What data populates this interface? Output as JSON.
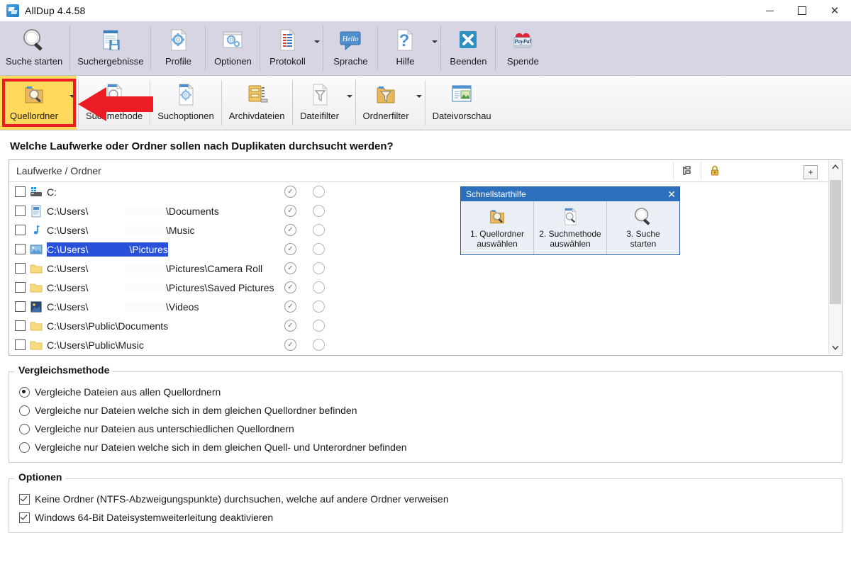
{
  "window": {
    "title": "AllDup 4.4.58",
    "app_icon": "alldup-logo-icon",
    "controls": {
      "minimize": "–",
      "maximize": "□",
      "close": "✕"
    }
  },
  "ribbon_top": {
    "buttons": [
      {
        "label": "Suche starten",
        "icon": "magnifier-icon",
        "has_dropdown": false
      },
      {
        "label": "Suchergebnisse",
        "icon": "results-save-icon",
        "has_dropdown": false
      },
      {
        "label": "Profile",
        "icon": "profile-gear-page-icon",
        "has_dropdown": false
      },
      {
        "label": "Optionen",
        "icon": "options-gear-window-icon",
        "has_dropdown": false
      },
      {
        "label": "Protokoll",
        "icon": "log-document-icon",
        "has_dropdown": true
      },
      {
        "label": "Sprache",
        "icon": "hello-speech-bubble-icon",
        "has_dropdown": false
      },
      {
        "label": "Hilfe",
        "icon": "question-mark-page-icon",
        "has_dropdown": true
      },
      {
        "label": "Beenden",
        "icon": "exit-x-icon",
        "has_dropdown": false
      },
      {
        "label": "Spende",
        "icon": "paypal-heart-icon",
        "has_dropdown": false
      }
    ]
  },
  "ribbon_bottom": {
    "buttons": [
      {
        "label": "Quellordner",
        "icon": "source-folder-search-icon",
        "has_dropdown": true,
        "highlighted": true
      },
      {
        "label": "Suchmethode",
        "icon": "search-method-page-icon",
        "has_dropdown": false
      },
      {
        "label": "Suchoptionen",
        "icon": "search-options-gear-icon",
        "has_dropdown": false
      },
      {
        "label": "Archivdateien",
        "icon": "archive-zip-icon",
        "has_dropdown": false
      },
      {
        "label": "Dateifilter",
        "icon": "file-filter-funnel-icon",
        "has_dropdown": true
      },
      {
        "label": "Ordnerfilter",
        "icon": "folder-filter-funnel-icon",
        "has_dropdown": true
      },
      {
        "label": "Dateivorschau",
        "icon": "file-preview-image-icon",
        "has_dropdown": false
      }
    ]
  },
  "annotation": {
    "arrow": "red-left-arrow",
    "arrow_color": "#ec1c24",
    "highlight_color": "#ffd95b"
  },
  "main": {
    "question": "Welche Laufwerke oder Ordner sollen nach Duplikaten durchsucht werden?",
    "list": {
      "header": {
        "main": "Laufwerke / Ordner",
        "col_tree": "tree-hierarchy-icon",
        "col_lock": "padlock-icon"
      },
      "add_button": "+",
      "rows": [
        {
          "icon": "drive-icon",
          "path": "C:",
          "suffix": "",
          "checked": false,
          "selected": false,
          "blurred": false,
          "included": true,
          "locked": false
        },
        {
          "icon": "documents-icon",
          "path": "C:\\Users\\",
          "suffix": "\\Documents",
          "checked": false,
          "selected": false,
          "blurred": true,
          "included": true,
          "locked": false
        },
        {
          "icon": "music-icon",
          "path": "C:\\Users\\",
          "suffix": "\\Music",
          "checked": false,
          "selected": false,
          "blurred": true,
          "included": true,
          "locked": false
        },
        {
          "icon": "pictures-icon",
          "path": "C:\\Users\\",
          "suffix": "\\Pictures",
          "checked": false,
          "selected": true,
          "blurred": true,
          "included": true,
          "locked": false
        },
        {
          "icon": "folder-icon",
          "path": "C:\\Users\\",
          "suffix": "\\Pictures\\Camera Roll",
          "checked": false,
          "selected": false,
          "blurred": true,
          "included": true,
          "locked": false
        },
        {
          "icon": "folder-icon",
          "path": "C:\\Users\\",
          "suffix": "\\Pictures\\Saved Pictures",
          "checked": false,
          "selected": false,
          "blurred": true,
          "included": true,
          "locked": false
        },
        {
          "icon": "videos-icon",
          "path": "C:\\Users\\",
          "suffix": "\\Videos",
          "checked": false,
          "selected": false,
          "blurred": true,
          "included": true,
          "locked": false
        },
        {
          "icon": "folder-icon",
          "path": "C:\\Users\\Public\\Documents",
          "suffix": "",
          "checked": false,
          "selected": false,
          "blurred": false,
          "included": true,
          "locked": false
        },
        {
          "icon": "folder-icon",
          "path": "C:\\Users\\Public\\Music",
          "suffix": "",
          "checked": false,
          "selected": false,
          "blurred": false,
          "included": true,
          "locked": false
        }
      ]
    },
    "quickstart": {
      "title": "Schnellstarthilfe",
      "close": "✕",
      "items": [
        {
          "icon": "source-folder-search-icon",
          "line1": "1. Quellordner",
          "line2": "auswählen"
        },
        {
          "icon": "search-method-page-icon",
          "line1": "2. Suchmethode",
          "line2": "auswählen"
        },
        {
          "icon": "magnifier-icon",
          "line1": "3. Suche",
          "line2": "starten"
        }
      ]
    },
    "compare_group": {
      "legend": "Vergleichsmethode",
      "options": [
        {
          "label": "Vergleiche Dateien aus allen Quellordnern",
          "selected": true
        },
        {
          "label": "Vergleiche nur Dateien welche sich in dem gleichen Quellordner befinden",
          "selected": false
        },
        {
          "label": "Vergleiche nur Dateien aus unterschiedlichen Quellordnern",
          "selected": false
        },
        {
          "label": "Vergleiche nur Dateien welche sich in dem gleichen Quell- und Unterordner befinden",
          "selected": false
        }
      ]
    },
    "options_group": {
      "legend": "Optionen",
      "checkboxes": [
        {
          "label": "Keine Ordner (NTFS-Abzweigungspunkte) durchsuchen, welche auf andere Ordner verweisen",
          "checked": true
        },
        {
          "label": "Windows 64-Bit Dateisystemweiterleitung deaktivieren",
          "checked": true
        }
      ]
    }
  }
}
